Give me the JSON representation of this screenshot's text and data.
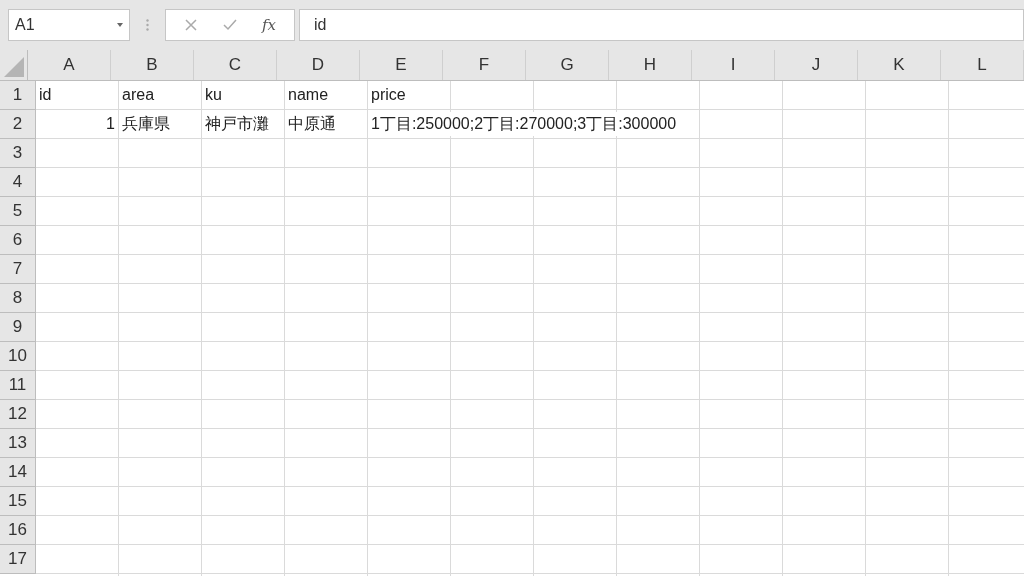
{
  "formula_bar": {
    "name_box": "A1",
    "function_label": "fx",
    "formula": "id"
  },
  "columns": [
    "A",
    "B",
    "C",
    "D",
    "E",
    "F",
    "G",
    "H",
    "I",
    "J",
    "K",
    "L"
  ],
  "rows": [
    {
      "header": "1",
      "cells": [
        {
          "kind": "text",
          "text": "id"
        },
        {
          "kind": "text",
          "text": "area"
        },
        {
          "kind": "text",
          "text": "ku"
        },
        {
          "kind": "text",
          "text": "name"
        },
        {
          "kind": "text",
          "text": "price"
        }
      ]
    },
    {
      "header": "2",
      "cells": [
        {
          "kind": "number",
          "text": "1"
        },
        {
          "kind": "text",
          "text": "兵庫県"
        },
        {
          "kind": "text",
          "text": "神戸市灘"
        },
        {
          "kind": "text",
          "text": "中原通"
        },
        {
          "kind": "text",
          "text": "1丁目:250000;2丁目:270000;3丁目:300000"
        }
      ]
    },
    {
      "header": "3",
      "cells": []
    },
    {
      "header": "4",
      "cells": []
    },
    {
      "header": "5",
      "cells": []
    },
    {
      "header": "6",
      "cells": []
    },
    {
      "header": "7",
      "cells": []
    },
    {
      "header": "8",
      "cells": []
    },
    {
      "header": "9",
      "cells": []
    },
    {
      "header": "10",
      "cells": []
    },
    {
      "header": "11",
      "cells": []
    },
    {
      "header": "12",
      "cells": []
    },
    {
      "header": "13",
      "cells": []
    },
    {
      "header": "14",
      "cells": []
    },
    {
      "header": "15",
      "cells": []
    },
    {
      "header": "16",
      "cells": []
    },
    {
      "header": "17",
      "cells": []
    }
  ]
}
